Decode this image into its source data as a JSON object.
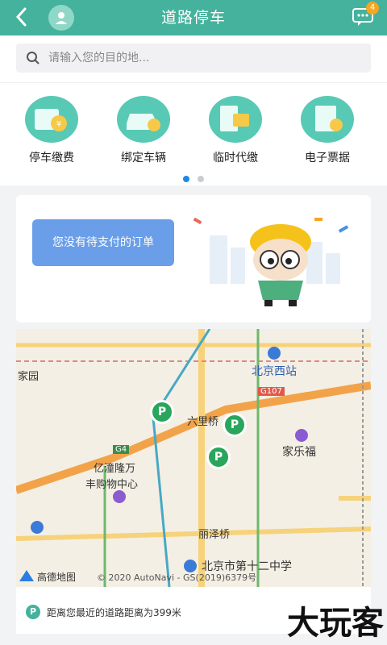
{
  "header": {
    "title": "道路停车",
    "message_count": "4"
  },
  "search": {
    "placeholder": "请输入您的目的地..."
  },
  "quick_actions": [
    {
      "label": "停车缴费",
      "icon": "parking-pay-icon"
    },
    {
      "label": "绑定车辆",
      "icon": "bind-car-icon"
    },
    {
      "label": "临时代缴",
      "icon": "temp-pay-icon"
    },
    {
      "label": "电子票据",
      "icon": "e-receipt-icon"
    }
  ],
  "pager": {
    "pages": 2,
    "active": 0
  },
  "orders": {
    "empty_text": "您没有待支付的订单"
  },
  "map": {
    "labels": {
      "jiayuan": "家园",
      "beijing_west": "北京西站",
      "liulichang": "六里桥",
      "jialefu": "家乐福",
      "yitong": "亿潼隆万",
      "fenggou": "丰购物中心",
      "lizeqiao": "丽泽桥",
      "school": "北京市第十二中学",
      "g107": "G107",
      "g4": "G4"
    },
    "brand": "高德地图",
    "copyright": "© 2020 AutoNavi - GS(2019)6379号"
  },
  "distance": {
    "text": "距离您最近的道路距离为399米"
  },
  "watermark": "大玩客",
  "colors": {
    "primary": "#45b29d",
    "accent": "#1e88e5",
    "bubble": "#6a9ee9"
  }
}
